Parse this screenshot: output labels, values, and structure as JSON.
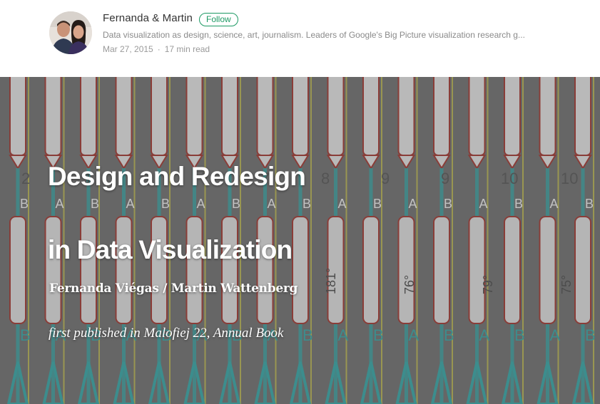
{
  "author": {
    "name": "Fernanda & Martin",
    "follow_label": "Follow",
    "bio": "Data visualization as design, science, art, journalism. Leaders of Google's Big Picture visualization research g...",
    "date": "Mar 27, 2015",
    "read_time": "17 min read",
    "separator": "·"
  },
  "hero": {
    "title_line_1": "Design and Redesign",
    "title_line_2": "in Data Visualization",
    "authors": "Fernanda Viégas / Martin Wattenberg",
    "publication_note": "first published in Malofiej 22, Annual Book",
    "image_labels": {
      "numbers": [
        "2",
        "3",
        "6",
        "7",
        "7",
        "8",
        "9",
        "9",
        "10",
        "10"
      ],
      "letters": [
        "B",
        "A",
        "B",
        "A",
        "B",
        "A",
        "B",
        "A",
        "B",
        "A",
        "B",
        "A",
        "B",
        "A",
        "B",
        "A",
        "B"
      ],
      "degrees": [
        "181°",
        "76°",
        "79°",
        "75°"
      ]
    }
  },
  "colors": {
    "follow_green": "#1c9963",
    "hero_gray": "#747474",
    "hero_teal": "#3aa9a9",
    "hero_yellow": "#d8d24a",
    "hero_red": "#a53b34"
  }
}
